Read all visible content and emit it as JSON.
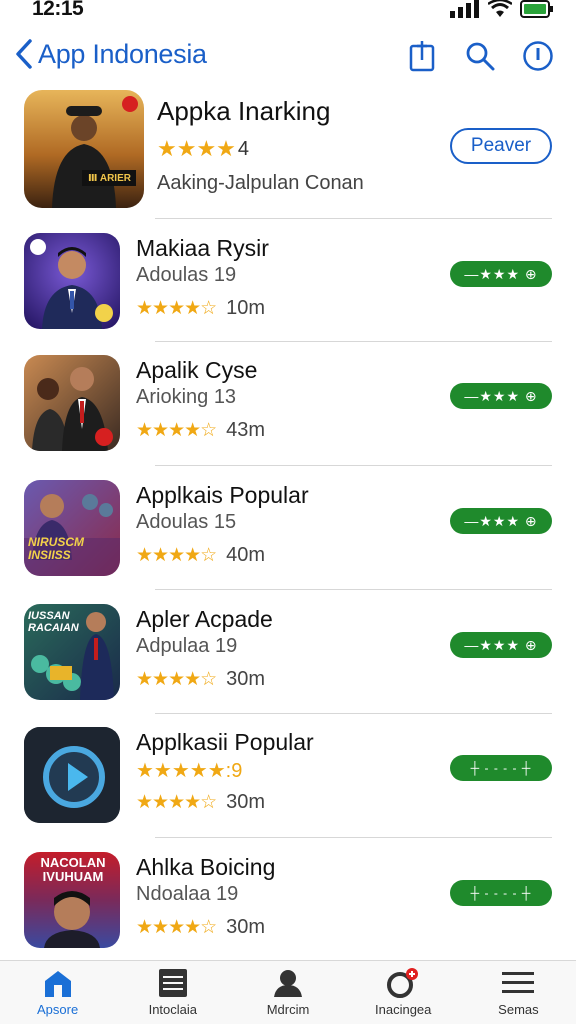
{
  "status": {
    "time": "12:15"
  },
  "nav": {
    "back_label": "App Indonesia"
  },
  "featured": {
    "title": "Appka Inarking",
    "stars": "★★★★",
    "rating": "4",
    "subtitle": "Aaking-Jalpulan Conan",
    "button_label": "Peaver",
    "thumb_text": "Ⅲ ARIER"
  },
  "apps": [
    {
      "title": "Makiaa Rysir",
      "sub": "Adoulas 19",
      "stars": "★★★★☆",
      "count": "10m",
      "pill": "—★★★ ⊕"
    },
    {
      "title": "Apalik Cyse",
      "sub": "Arioking 13",
      "stars": "★★★★☆",
      "count": "43m",
      "pill": "—★★★ ⊕"
    },
    {
      "title": "Applkais Popular",
      "sub": "Adoulas 15",
      "stars": "★★★★☆",
      "count": "40m",
      "pill": "—★★★ ⊕"
    },
    {
      "title": "Apler Acpade",
      "sub": "Adpulaa 19",
      "stars": "★★★★☆",
      "count": "30m",
      "pill": "—★★★ ⊕"
    },
    {
      "title": "Applkasii Popular",
      "sub": "★★★★★:9",
      "stars": "★★★★☆",
      "count": "30m",
      "pill": "┼ - - - - ┼"
    },
    {
      "title": "Ahlka Boicing",
      "sub": "Ndoalaa 19",
      "stars": "★★★★☆",
      "count": "30m",
      "pill": "┼ - - - - ┼"
    }
  ],
  "thumb_text": {
    "app3": "NIRUSCM INSIISS",
    "app4": "IUSSAN RACAIAN",
    "app6": "NACOLAN IVUHUAM"
  },
  "tabs": [
    {
      "label": "Apsore",
      "icon": "home-icon"
    },
    {
      "label": "Intoclaia",
      "icon": "list-icon"
    },
    {
      "label": "Mdrcim",
      "icon": "person-icon"
    },
    {
      "label": "Inacingea",
      "icon": "updates-icon"
    },
    {
      "label": "Semas",
      "icon": "menu-icon"
    }
  ],
  "colors": {
    "accent": "#1a5fc8",
    "star": "#f0a814",
    "pill": "#1f8a2c"
  }
}
